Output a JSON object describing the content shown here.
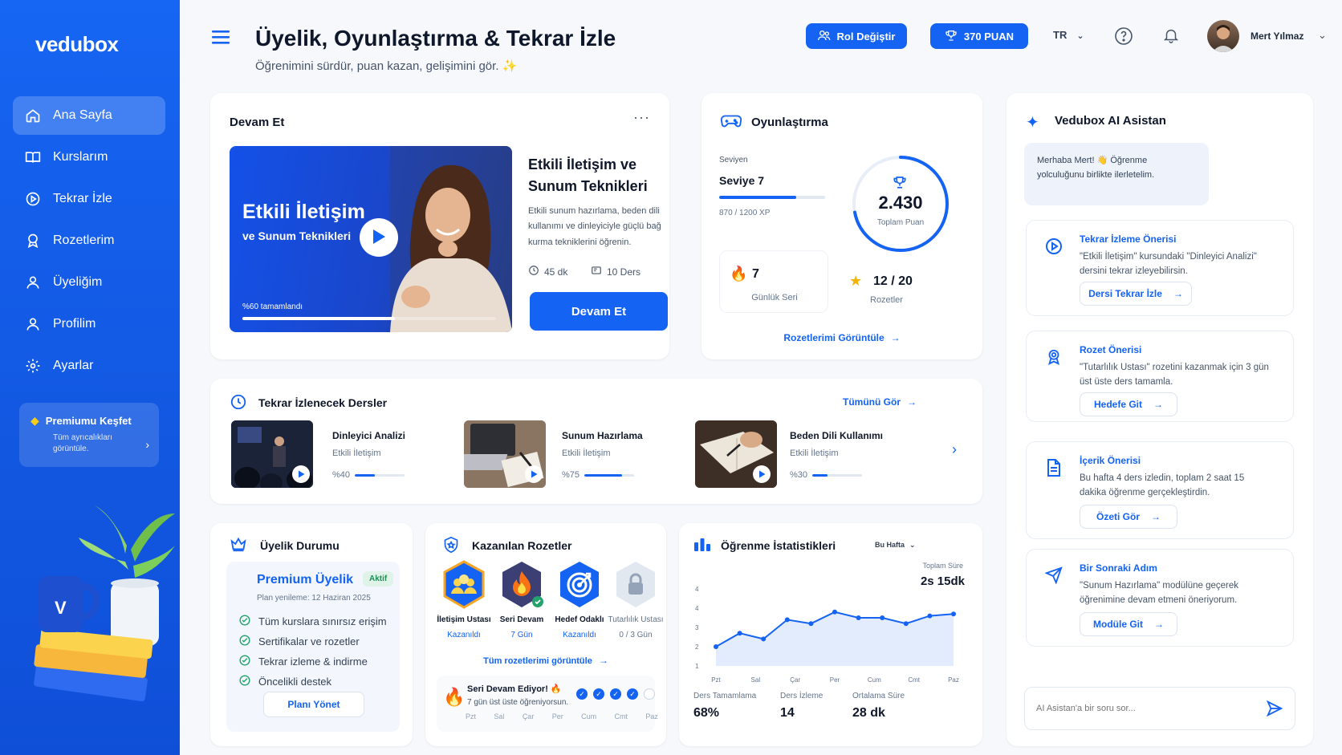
{
  "sidebar": {
    "logo": "vedubox",
    "items": [
      {
        "label": "Ana Sayfa",
        "icon": "home-icon"
      },
      {
        "label": "Kurslarım",
        "icon": "book-icon"
      },
      {
        "label": "Tekrar İzle",
        "icon": "play-circle-icon"
      },
      {
        "label": "Rozetlerim",
        "icon": "award-icon"
      },
      {
        "label": "Üyeliğim",
        "icon": "user-icon"
      },
      {
        "label": "Profilim",
        "icon": "user-icon"
      },
      {
        "label": "Ayarlar",
        "icon": "gear-icon"
      }
    ],
    "promo": {
      "title": "Premiumu Keşfet",
      "subtitle": "Tüm ayrıcalıkları görüntüle."
    }
  },
  "header": {
    "title": "Üyelik, Oyunlaştırma & Tekrar İzle",
    "subtitle": "Öğrenimini sürdür, puan kazan, gelişimini gör. ✨",
    "role_button": "Rol Değiştir",
    "points_button": "370 PUAN",
    "language": "TR",
    "user_name": "Mert Yılmaz"
  },
  "continue": {
    "title": "Devam Et",
    "video_title_line1": "Etkili İletişim",
    "video_title_line2": "ve Sunum Teknikleri",
    "video_progress_text": "%60 tamamlandı",
    "video_progress": 0.6,
    "course_title": "Etkili İletişim ve Sunum Teknikleri",
    "course_desc": "Etkili sunum hazırlama, beden dili kullanımı ve dinleyiciyle güçlü bağ kurma tekniklerini öğrenin.",
    "duration": "45 dk",
    "lessons": "10 Ders",
    "cta": "Devam Et"
  },
  "gamification": {
    "title": "Oyunlaştırma",
    "level_label": "Seviyen",
    "level": "Seviye 7",
    "xp": "870 / 1200 XP",
    "xp_progress": 0.725,
    "total_points": "2.430",
    "total_label": "Toplam Puan",
    "total_progress": 0.72,
    "streak_value": "7",
    "streak_label": "Günlük Seri",
    "badges_value": "12 / 20",
    "badges_label": "Rozetler",
    "link": "Rozetlerimi Görüntüle"
  },
  "rewatch": {
    "title": "Tekrar İzlenecek Dersler",
    "see_all": "Tümünü Gör",
    "items": [
      {
        "title": "Dinleyici Analizi",
        "course": "Etkili İletişim",
        "percent_text": "%40",
        "progress": 0.4
      },
      {
        "title": "Sunum Hazırlama",
        "course": "Etkili İletişim",
        "percent_text": "%75",
        "progress": 0.75
      },
      {
        "title": "Beden Dili Kullanımı",
        "course": "Etkili İletişim",
        "percent_text": "%30",
        "progress": 0.3
      }
    ]
  },
  "membership": {
    "title": "Üyelik Durumu",
    "plan": "Premium Üyelik",
    "status": "Aktif",
    "renewal": "Plan yenileme: 12 Haziran 2025",
    "features": [
      "Tüm kurslara sınırsız erişim",
      "Sertifikalar ve rozetler",
      "Tekrar izleme & indirme",
      "Öncelikli destek"
    ],
    "manage": "Planı Yönet"
  },
  "badges": {
    "title": "Kazanılan Rozetler",
    "items": [
      {
        "name": "İletişim Ustası",
        "status": "Kazanıldı",
        "color": "#1463f3"
      },
      {
        "name": "Seri Devam",
        "status": "7 Gün",
        "color": "#3b3f73"
      },
      {
        "name": "Hedef Odaklı",
        "status": "Kazanıldı",
        "color": "#1463f3"
      },
      {
        "name": "Tutarlılık Ustası",
        "status": "0 / 3 Gün",
        "color": "#cbd5e1"
      }
    ],
    "link": "Tüm rozetlerimi görüntüle",
    "streak_title": "Seri Devam Ediyor! 🔥",
    "streak_sub": "7 gün üst üste öğreniyorsun.",
    "days": [
      "Pzt",
      "Sal",
      "Çar",
      "Per",
      "Cum",
      "Cmt",
      "Paz"
    ],
    "days_done": [
      true,
      true,
      true,
      true,
      true,
      true,
      false
    ]
  },
  "stats": {
    "title": "Öğrenme İstatistikleri",
    "period": "Bu Hafta",
    "total_label": "Toplam Süre",
    "total_value": "2s 15dk",
    "completion_label": "Ders Tamamlama",
    "completion_value": "68%",
    "watch_label": "Ders İzleme",
    "watch_value": "14",
    "avg_label": "Ortalama Süre",
    "avg_value": "28 dk"
  },
  "chart_data": {
    "type": "line",
    "categories": [
      "Pzt",
      "Sal",
      "Çar",
      "Per",
      "Cum",
      "Cmt",
      "Paz"
    ],
    "x": [
      "Pzt",
      "Sal",
      "Çar",
      "Per",
      "Cum",
      "Cmt",
      "Paz"
    ],
    "series": [
      {
        "values": [
          2.0,
          2.7,
          2.4,
          3.4,
          3.2,
          3.8,
          3.5,
          3.5,
          3.2,
          3.6,
          3.7
        ]
      }
    ],
    "y_ticks": [
      "1",
      "2",
      "3",
      "4",
      "4"
    ],
    "ylim": [
      1,
      5
    ],
    "grid": false
  },
  "assistant": {
    "title": "Vedubox AI Asistan",
    "greeting": "Merhaba Mert! 👋 Öğrenme yolculuğunu birlikte ilerletelim.",
    "cards": [
      {
        "title": "Tekrar İzleme Önerisi",
        "text": "\"Etkili İletişim\" kursundaki \"Dinleyici Analizi\" dersini tekrar izleyebilirsin.",
        "button": "Dersi Tekrar İzle"
      },
      {
        "title": "Rozet Önerisi",
        "text": "\"Tutarlılık Ustası\" rozetini kazanmak için 3 gün üst üste ders tamamla.",
        "button": "Hedefe Git"
      },
      {
        "title": "İçerik Önerisi",
        "text": "Bu hafta 4 ders izledin, toplam 2 saat 15 dakika öğrenme gerçekleştirdin.",
        "button": "Özeti Gör"
      },
      {
        "title": "Bir Sonraki Adım",
        "text": "\"Sunum Hazırlama\" modülüne geçerek öğrenimine devam etmeni öneriyorum.",
        "button": "Modüle Git"
      }
    ],
    "input_placeholder": "AI Asistan'a bir soru sor..."
  },
  "colors": {
    "primary": "#1463f3",
    "success": "#22a36b",
    "flame": "#f59e0b"
  }
}
